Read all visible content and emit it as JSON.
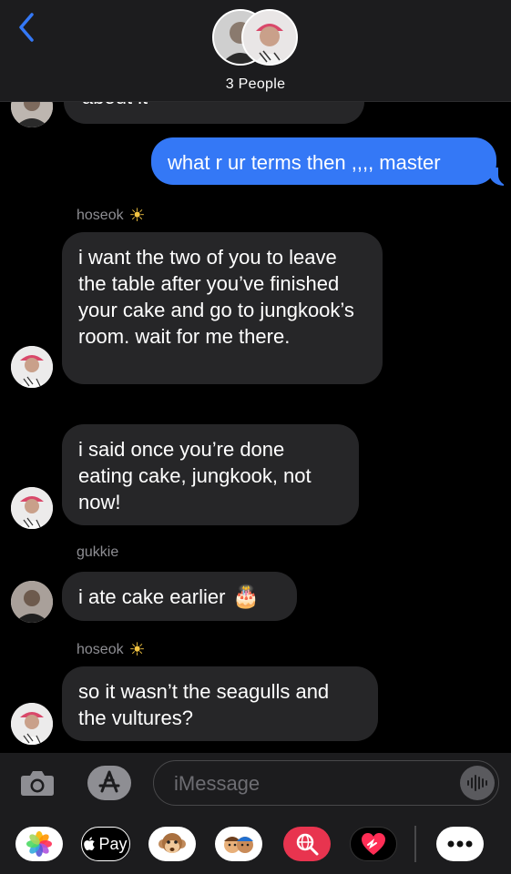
{
  "header": {
    "back_icon": "chevron-left-icon",
    "group_label": "3 People"
  },
  "conversation": {
    "partial_top_text": "about it",
    "messages": [
      {
        "direction": "outgoing",
        "text": "what r ur terms then ,,,, master"
      },
      {
        "direction": "incoming",
        "sender": "hoseok",
        "sender_emoji": "☀",
        "text": "i want the two of you to leave the table after you’ve finished your cake and go to jungkook’s room. wait for me there."
      },
      {
        "direction": "incoming",
        "text": "i said once you’re done eating cake, jungkook, not now!"
      },
      {
        "direction": "incoming",
        "sender": "gukkie",
        "text": "i ate cake earlier",
        "emoji": "🎂"
      },
      {
        "direction": "incoming",
        "sender": "hoseok",
        "sender_emoji": "☀",
        "text": "so it wasn’t the seagulls and the vultures?"
      }
    ]
  },
  "input": {
    "camera_icon": "camera-icon",
    "appstore_icon": "app-store-icon",
    "placeholder": "iMessage",
    "audio_icon": "audio-waveform-icon"
  },
  "app_drawer": {
    "items": [
      {
        "name": "photos-app-icon"
      },
      {
        "name": "apple-pay-icon",
        "label": "Pay"
      },
      {
        "name": "animoji-icon"
      },
      {
        "name": "memoji-icon"
      },
      {
        "name": "web-images-search-icon"
      },
      {
        "name": "digital-touch-icon"
      },
      {
        "name": "more-apps-icon"
      }
    ]
  },
  "colors": {
    "background": "#000000",
    "bar_background": "#1c1c1e",
    "incoming_bubble": "#262628",
    "outgoing_bubble": "#3478f6",
    "accent": "#3478f6"
  }
}
